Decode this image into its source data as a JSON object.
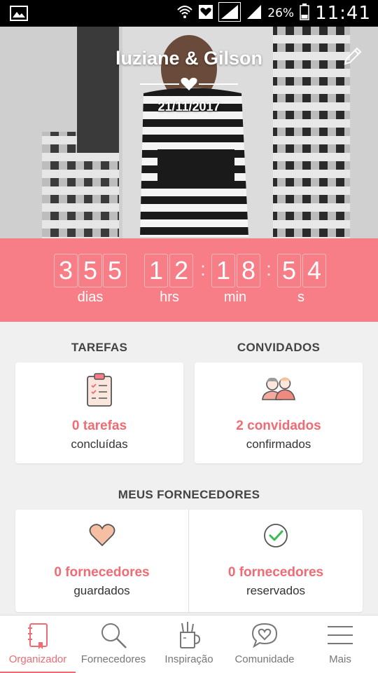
{
  "status_bar": {
    "battery": "26%",
    "time": "11:41",
    "icons": [
      "gallery-icon",
      "wifi-icon",
      "heart-notification-icon",
      "signal-icon",
      "signal-icon",
      "battery-icon"
    ]
  },
  "hero": {
    "couple_names": "luziane & Gilson",
    "date": "21/11/2017"
  },
  "countdown": {
    "days": [
      "3",
      "5",
      "5"
    ],
    "hours": [
      "1",
      "2"
    ],
    "minutes": [
      "1",
      "8"
    ],
    "seconds": [
      "5",
      "4"
    ],
    "labels": {
      "days": "dias",
      "hours": "hrs",
      "minutes": "min",
      "seconds": "s"
    }
  },
  "tasks": {
    "title": "TAREFAS",
    "count": "0 tarefas",
    "sub": "concluídas"
  },
  "guests": {
    "title": "CONVIDADOS",
    "count": "2 convidados",
    "sub": "confirmados"
  },
  "vendors": {
    "title": "MEUS FORNECEDORES",
    "saved": {
      "count": "0 fornecedores",
      "sub": "guardados"
    },
    "reserved": {
      "count": "0 fornecedores",
      "sub": "reservados"
    }
  },
  "bottom_nav": {
    "items": [
      {
        "label": "Organizador",
        "icon": "planner-icon",
        "active": true
      },
      {
        "label": "Fornecedores",
        "icon": "search-icon",
        "active": false
      },
      {
        "label": "Inspiração",
        "icon": "inspiration-icon",
        "active": false
      },
      {
        "label": "Comunidade",
        "icon": "community-icon",
        "active": false
      },
      {
        "label": "Mais",
        "icon": "menu-icon",
        "active": false
      }
    ]
  },
  "colors": {
    "accent": "#f77e86",
    "accent_text": "#f06b73"
  }
}
